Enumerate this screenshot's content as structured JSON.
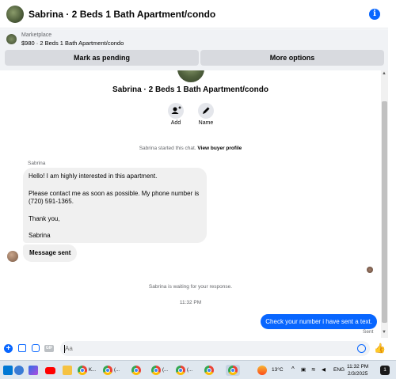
{
  "header": {
    "title": "Sabrina · 2 Beds 1 Bath Apartment/condo",
    "info_icon": "info-icon"
  },
  "marketplace": {
    "label": "Marketplace",
    "listing": "$980 · 2 Beds 1 Bath Apartment/condo",
    "mark_pending_label": "Mark as pending",
    "more_options_label": "More options"
  },
  "chat": {
    "title": "Sabrina · 2 Beds 1 Bath Apartment/condo",
    "actions": [
      {
        "label": "Add",
        "icon": "add-person-icon"
      },
      {
        "label": "Name",
        "icon": "pencil-icon"
      }
    ],
    "started_text": "Sabrina started this chat.",
    "view_profile_link": "View buyer profile",
    "sender_name": "Sabrina",
    "incoming_message": {
      "line1": "Hello!  I am highly interested in this apartment.",
      "line2": "Please contact me as soon as possible.  My phone number is",
      "line3": "(720) 591-1365.",
      "line4": "Thank you,",
      "line5": "Sabrina"
    },
    "message_sent_bubble": "Message sent",
    "waiting_text": "Sabrina is waiting for your response.",
    "timestamp": "11:32 PM",
    "outgoing_message": "Check your number i have sent a text.",
    "outgoing_status": "Sent"
  },
  "composer": {
    "placeholder": "Aa"
  },
  "taskbar": {
    "apps": [
      {
        "label": "K...",
        "icon": "chrome-icon"
      },
      {
        "label": "(...",
        "icon": "chrome-icon"
      },
      {
        "label": "(...",
        "icon": "chrome-icon"
      },
      {
        "label": "(...",
        "icon": "chrome-icon"
      }
    ],
    "weather": "13°C",
    "language": "ENG",
    "time": "11:32 PM",
    "date": "2/3/2025",
    "notification_count": "1"
  },
  "colors": {
    "accent": "#0866ff",
    "bubble_gray": "#f0f0f0",
    "bar_gray": "#f0f2f5"
  }
}
